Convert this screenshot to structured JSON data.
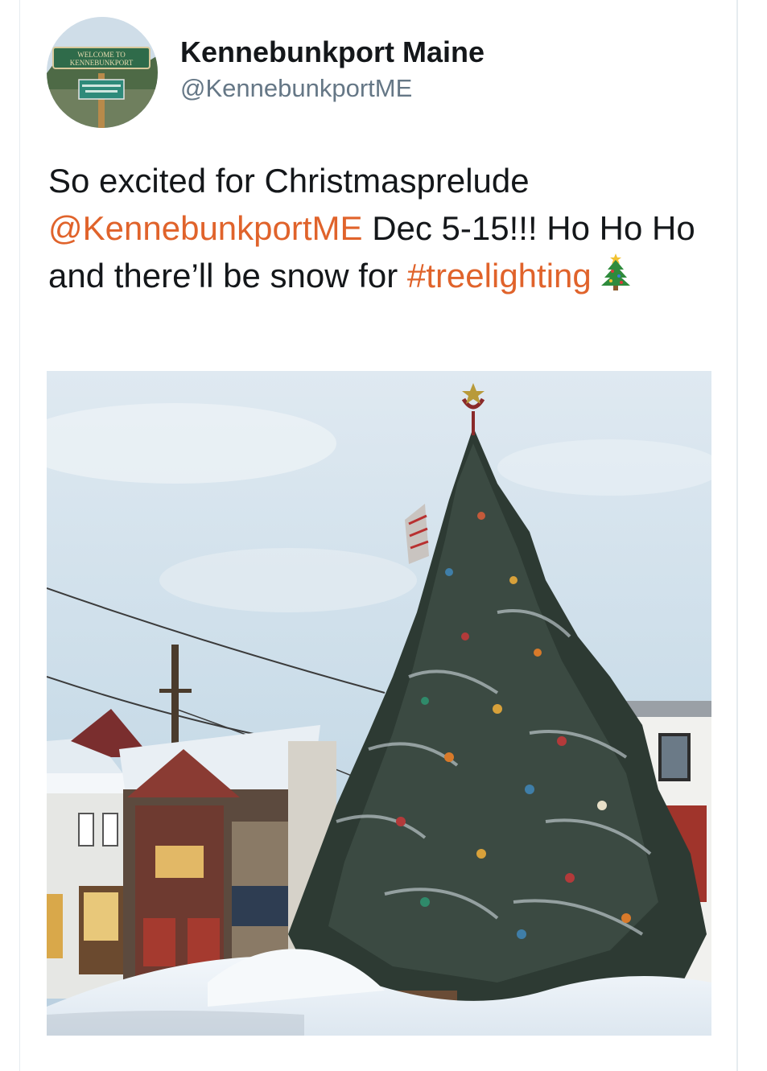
{
  "tweet": {
    "author_name": "Kennebunkport Maine",
    "author_handle": "@KennebunkportME",
    "avatar_sign_text": "WELCOME TO KENNEBUNKPORT",
    "text_part1": "So excited for Christmasprelude ",
    "mention": "@KennebunkportME",
    "text_part2": " Dec 5-15!!! Ho Ho Ho and there’ll be snow for ",
    "hashtag": "#treelighting",
    "emoji": "christmas-tree-icon"
  },
  "colors": {
    "link": "#e0632b",
    "name": "#14171a",
    "handle": "#657786",
    "sign_green": "#2f6b4a"
  }
}
